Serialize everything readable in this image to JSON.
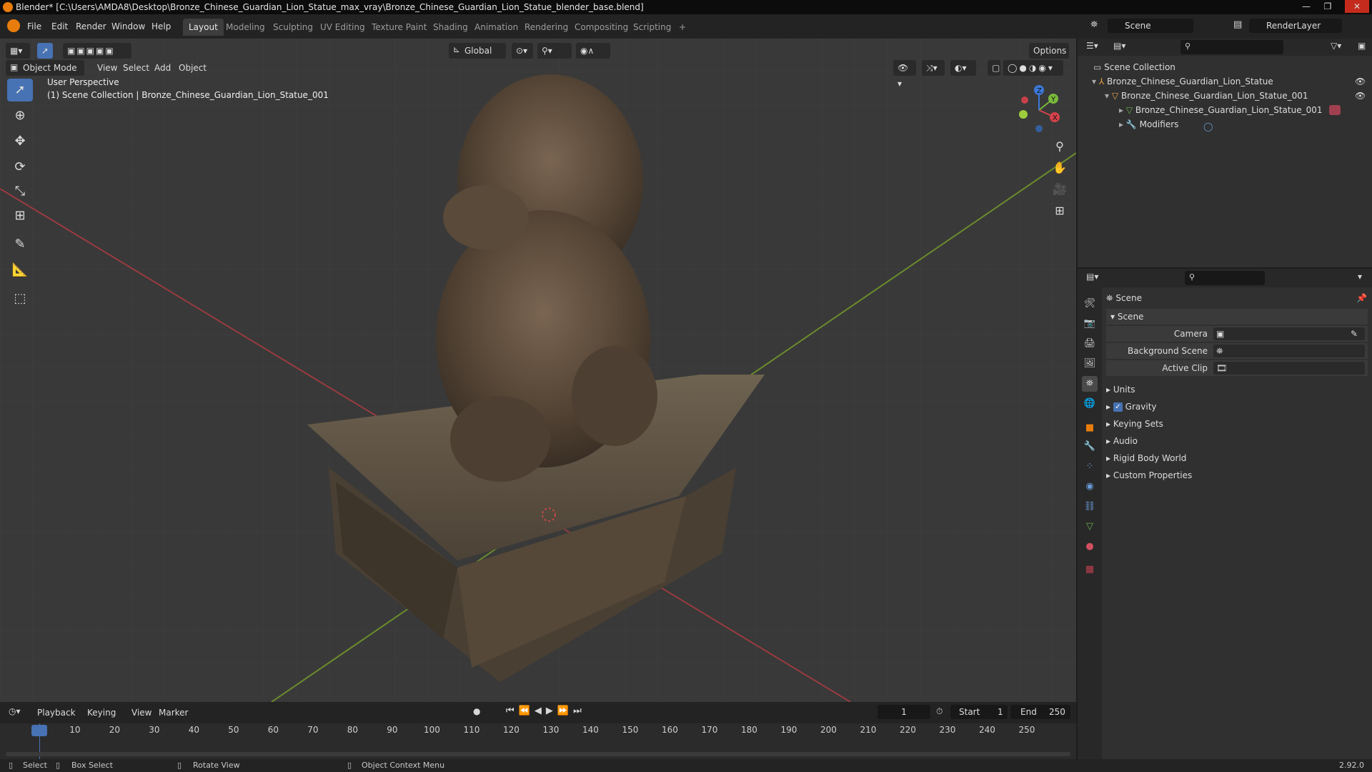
{
  "window": {
    "title": "Blender* [C:\\Users\\AMDA8\\Desktop\\Bronze_Chinese_Guardian_Lion_Statue_max_vray\\Bronze_Chinese_Guardian_Lion_Statue_blender_base.blend]"
  },
  "menu": [
    "File",
    "Edit",
    "Render",
    "Window",
    "Help"
  ],
  "workspaces": [
    "Layout",
    "Modeling",
    "Sculpting",
    "UV Editing",
    "Texture Paint",
    "Shading",
    "Animation",
    "Rendering",
    "Compositing",
    "Scripting",
    "+"
  ],
  "active_workspace": "Layout",
  "scene_field": "Scene",
  "renderlayer_field": "RenderLayer",
  "viewport": {
    "mode": "Object Mode",
    "header_menu": [
      "View",
      "Select",
      "Add",
      "Object"
    ],
    "transform_orientation": "Global",
    "options_label": "Options",
    "perspective_label": "User Perspective",
    "collection_label": "(1) Scene Collection | Bronze_Chinese_Guardian_Lion_Statue_001",
    "gizmo_axes": [
      "X",
      "Y",
      "Z"
    ]
  },
  "outliner": {
    "items": [
      {
        "label": "Scene Collection"
      },
      {
        "label": "Bronze_Chinese_Guardian_Lion_Statue"
      },
      {
        "label": "Bronze_Chinese_Guardian_Lion_Statue_001"
      },
      {
        "label": "Bronze_Chinese_Guardian_Lion_Statue_001"
      },
      {
        "label": "Modifiers"
      }
    ]
  },
  "properties": {
    "context_title": "Scene",
    "panel_title": "Scene",
    "fields": [
      {
        "label": "Camera"
      },
      {
        "label": "Background Scene"
      },
      {
        "label": "Active Clip"
      }
    ],
    "subpanels": [
      "Units",
      "Gravity",
      "Keying Sets",
      "Audio",
      "Rigid Body World",
      "Custom Properties"
    ],
    "gravity_checked": true
  },
  "timeline": {
    "menu": [
      "Playback",
      "Keying",
      "View",
      "Marker"
    ],
    "current_frame": "1",
    "start_label": "Start",
    "start_value": "1",
    "end_label": "End",
    "end_value": "250",
    "ticks": [
      "1",
      "10",
      "20",
      "30",
      "40",
      "50",
      "60",
      "70",
      "80",
      "90",
      "100",
      "110",
      "120",
      "130",
      "140",
      "150",
      "160",
      "170",
      "180",
      "190",
      "200",
      "210",
      "220",
      "230",
      "240",
      "250"
    ]
  },
  "statusbar": {
    "items": [
      "Select",
      "Box Select",
      "Rotate View",
      "Object Context Menu"
    ],
    "version": "2.92.0"
  },
  "colors": {
    "accent": "#4772b3",
    "x_axis": "#d4424b",
    "y_axis": "#7ab83b",
    "z_axis": "#3c78d8",
    "orange": "#e87d0d"
  }
}
